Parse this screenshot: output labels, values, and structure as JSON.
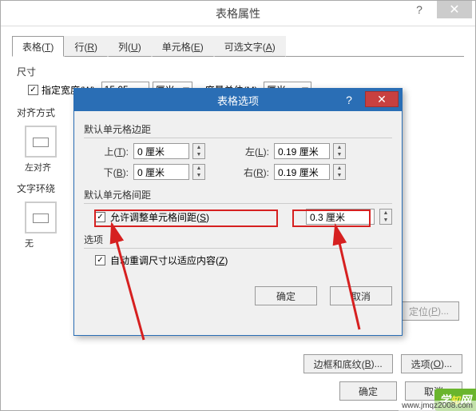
{
  "main": {
    "title": "表格属性",
    "tabs": [
      "表格(T)",
      "行(R)",
      "列(U)",
      "单元格(E)",
      "可选文字(A)"
    ],
    "size": {
      "group_label": "尺寸",
      "specify_width_label": "指定宽度(W):",
      "width_val": "15.05",
      "width_unit": "厘米",
      "measure_label": "度量单位(M):",
      "measure_val": "厘米"
    },
    "align": {
      "group_label": "对齐方式",
      "left_label": "左对齐"
    },
    "wrap": {
      "group_label": "文字环绕",
      "none_label": "无",
      "position_btn": "定位(P)..."
    },
    "borders_btn": "边框和底纹(B)...",
    "options_btn": "选项(O)...",
    "ok": "确定",
    "cancel": "取消"
  },
  "sub": {
    "title": "表格选项",
    "margins_label": "默认单元格边距",
    "top_label": "上(T):",
    "top_val": "0 厘米",
    "bottom_label": "下(B):",
    "bottom_val": "0 厘米",
    "left_label": "左(L):",
    "left_val": "0.19 厘米",
    "right_label": "右(R):",
    "right_val": "0.19 厘米",
    "spacing_label": "默认单元格间距",
    "allow_spacing_label": "允许调整单元格间距(S)",
    "spacing_val": "0.3 厘米",
    "options_label": "选项",
    "autofit_label": "自动重调尺寸以适应内容(Z)",
    "ok": "确定",
    "cancel": "取消"
  },
  "watermark": {
    "brand": "学知网",
    "url": "www.jmqz2008.com"
  },
  "icons": {
    "close": "✕",
    "help": "?",
    "spin_up": "▲",
    "spin_down": "▼"
  }
}
